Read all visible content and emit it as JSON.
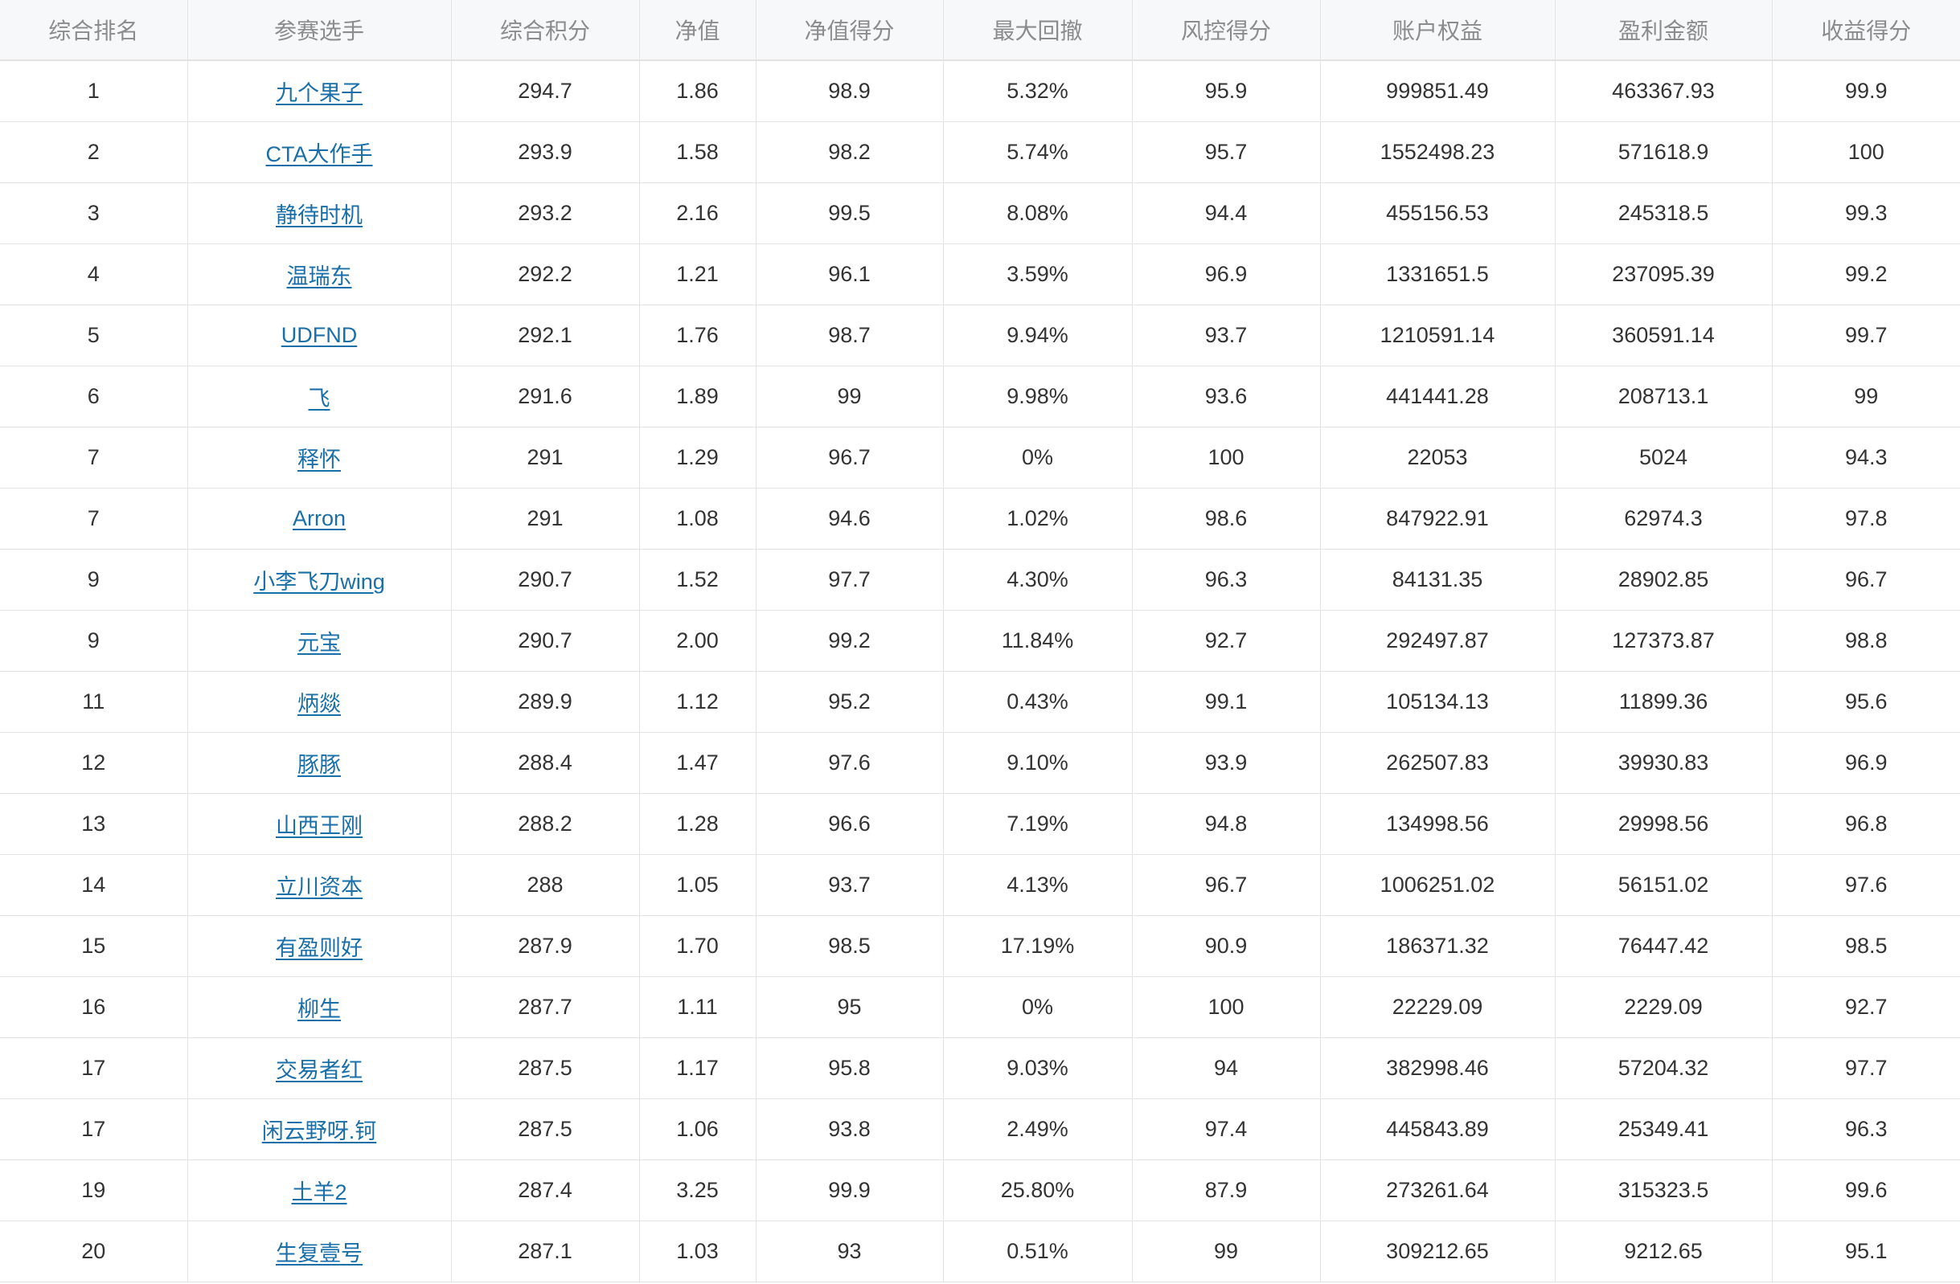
{
  "theme": {
    "link_color": "#1a6fa8",
    "header_bg": "#f7f8fa",
    "header_text_color": "#8c8c8c",
    "border_color": "#e3e3e3",
    "text_color": "#333333"
  },
  "table": {
    "columns": [
      "综合排名",
      "参赛选手",
      "综合积分",
      "净值",
      "净值得分",
      "最大回撤",
      "风控得分",
      "账户权益",
      "盈利金额",
      "收益得分"
    ],
    "rows": [
      [
        "1",
        "九个果子",
        "294.7",
        "1.86",
        "98.9",
        "5.32%",
        "95.9",
        "999851.49",
        "463367.93",
        "99.9"
      ],
      [
        "2",
        "CTA大作手",
        "293.9",
        "1.58",
        "98.2",
        "5.74%",
        "95.7",
        "1552498.23",
        "571618.9",
        "100"
      ],
      [
        "3",
        "静待时机",
        "293.2",
        "2.16",
        "99.5",
        "8.08%",
        "94.4",
        "455156.53",
        "245318.5",
        "99.3"
      ],
      [
        "4",
        "温瑞东",
        "292.2",
        "1.21",
        "96.1",
        "3.59%",
        "96.9",
        "1331651.5",
        "237095.39",
        "99.2"
      ],
      [
        "5",
        "UDFND",
        "292.1",
        "1.76",
        "98.7",
        "9.94%",
        "93.7",
        "1210591.14",
        "360591.14",
        "99.7"
      ],
      [
        "6",
        "飞",
        "291.6",
        "1.89",
        "99",
        "9.98%",
        "93.6",
        "441441.28",
        "208713.1",
        "99"
      ],
      [
        "7",
        "释怀",
        "291",
        "1.29",
        "96.7",
        "0%",
        "100",
        "22053",
        "5024",
        "94.3"
      ],
      [
        "7",
        "Arron",
        "291",
        "1.08",
        "94.6",
        "1.02%",
        "98.6",
        "847922.91",
        "62974.3",
        "97.8"
      ],
      [
        "9",
        "小李飞刀wing",
        "290.7",
        "1.52",
        "97.7",
        "4.30%",
        "96.3",
        "84131.35",
        "28902.85",
        "96.7"
      ],
      [
        "9",
        "元宝",
        "290.7",
        "2.00",
        "99.2",
        "11.84%",
        "92.7",
        "292497.87",
        "127373.87",
        "98.8"
      ],
      [
        "11",
        "炳燚",
        "289.9",
        "1.12",
        "95.2",
        "0.43%",
        "99.1",
        "105134.13",
        "11899.36",
        "95.6"
      ],
      [
        "12",
        "豚豚",
        "288.4",
        "1.47",
        "97.6",
        "9.10%",
        "93.9",
        "262507.83",
        "39930.83",
        "96.9"
      ],
      [
        "13",
        "山西王刚",
        "288.2",
        "1.28",
        "96.6",
        "7.19%",
        "94.8",
        "134998.56",
        "29998.56",
        "96.8"
      ],
      [
        "14",
        "立川资本",
        "288",
        "1.05",
        "93.7",
        "4.13%",
        "96.7",
        "1006251.02",
        "56151.02",
        "97.6"
      ],
      [
        "15",
        "有盈则好",
        "287.9",
        "1.70",
        "98.5",
        "17.19%",
        "90.9",
        "186371.32",
        "76447.42",
        "98.5"
      ],
      [
        "16",
        "柳生",
        "287.7",
        "1.11",
        "95",
        "0%",
        "100",
        "22229.09",
        "2229.09",
        "92.7"
      ],
      [
        "17",
        "交易者红",
        "287.5",
        "1.17",
        "95.8",
        "9.03%",
        "94",
        "382998.46",
        "57204.32",
        "97.7"
      ],
      [
        "17",
        "闲云野呀.钶",
        "287.5",
        "1.06",
        "93.8",
        "2.49%",
        "97.4",
        "445843.89",
        "25349.41",
        "96.3"
      ],
      [
        "19",
        "土羊2",
        "287.4",
        "3.25",
        "99.9",
        "25.80%",
        "87.9",
        "273261.64",
        "315323.5",
        "99.6"
      ],
      [
        "20",
        "生复壹号",
        "287.1",
        "1.03",
        "93",
        "0.51%",
        "99",
        "309212.65",
        "9212.65",
        "95.1"
      ]
    ]
  }
}
